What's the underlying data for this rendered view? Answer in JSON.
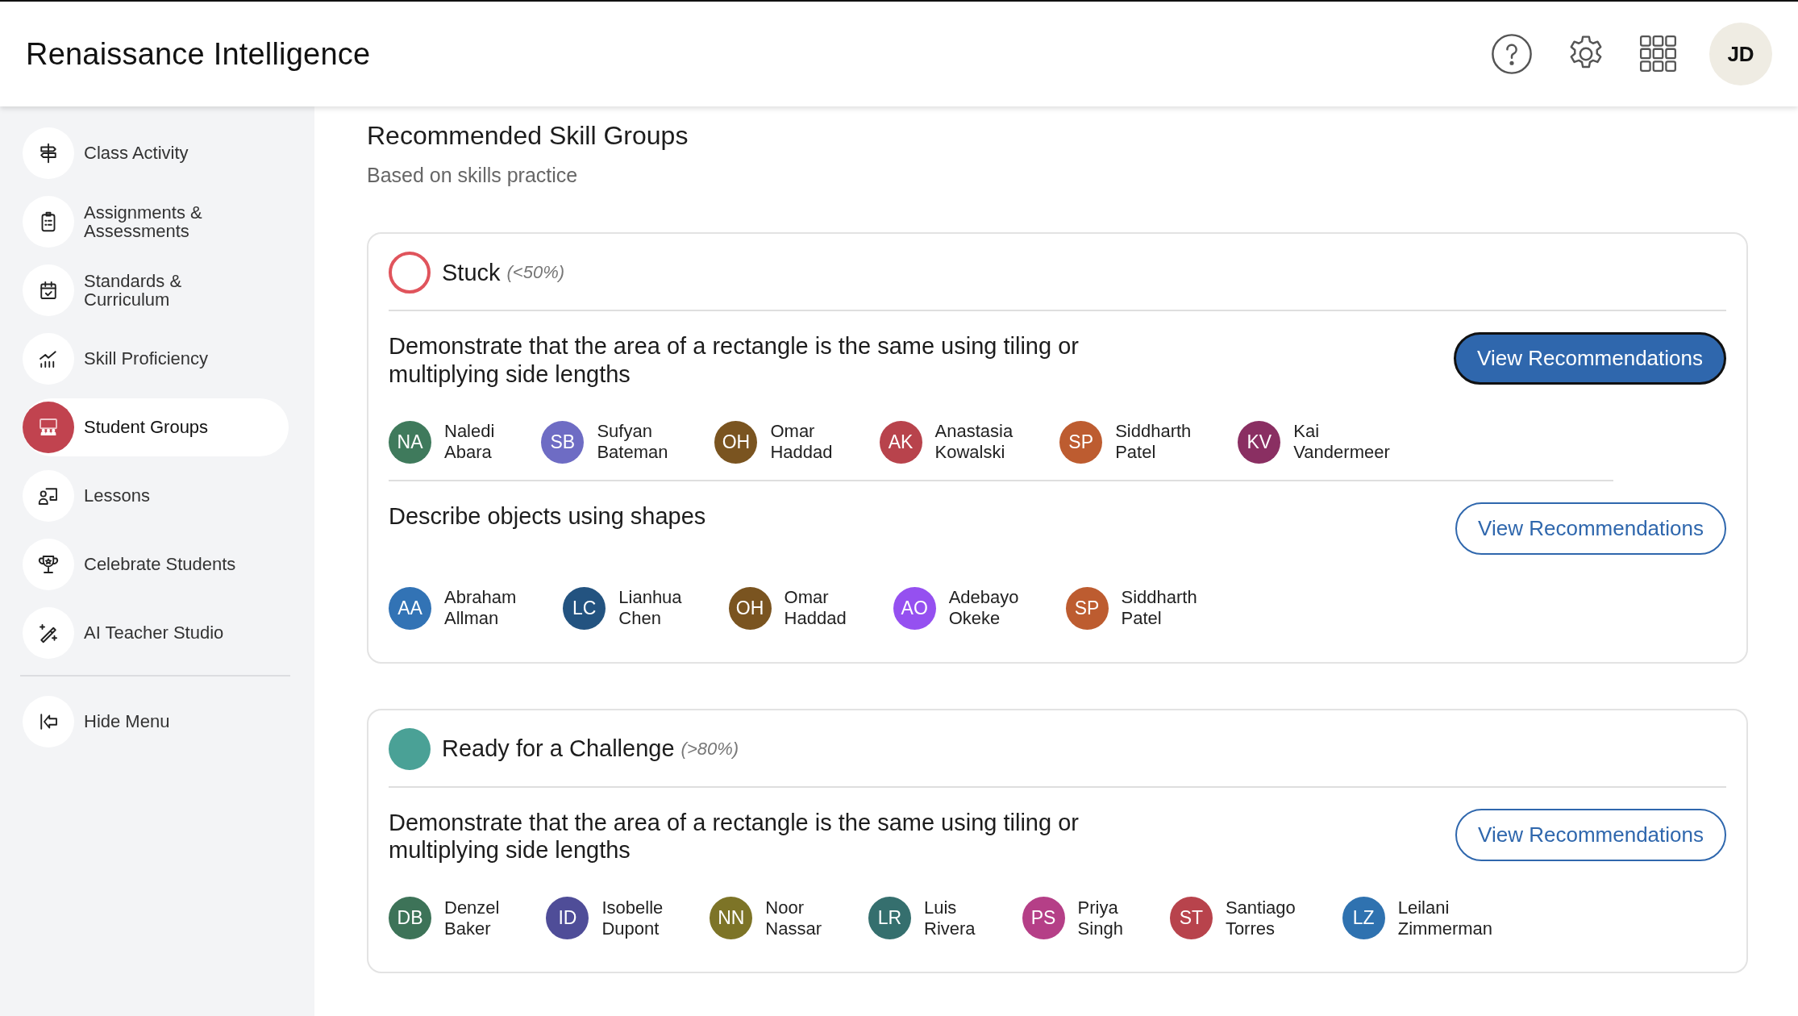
{
  "header": {
    "logo": "Renaissance Intelligence",
    "user_initials": "JD"
  },
  "sidebar": {
    "items": [
      {
        "label": "Class Activity",
        "selected": false
      },
      {
        "label": "Assignments & Assessments",
        "selected": false
      },
      {
        "label": "Standards & Curriculum",
        "selected": false
      },
      {
        "label": "Skill Proficiency",
        "selected": false
      },
      {
        "label": "Student Groups",
        "selected": true
      },
      {
        "label": "Lessons",
        "selected": false
      },
      {
        "label": "Celebrate Students",
        "selected": false
      },
      {
        "label": "AI Teacher Studio",
        "selected": false
      }
    ],
    "hide_menu": "Hide Menu"
  },
  "page": {
    "title": "Recommended Skill Groups",
    "subtitle": "Based on skills practice"
  },
  "groups": [
    {
      "name": "Stuck",
      "range": "(<50%)",
      "kind": "hollow",
      "color": "#e0545c",
      "skills": [
        {
          "title": "Demonstrate that the area of a rectangle is the same using tiling or multiplying side lengths",
          "button": "View Recommendations",
          "focused": true,
          "students": [
            {
              "initials": "NA",
              "first": "Naledi",
              "last": "Abara",
              "color": "#3f7a5c"
            },
            {
              "initials": "SB",
              "first": "Sufyan",
              "last": "Bateman",
              "color": "#6e6cc4"
            },
            {
              "initials": "OH",
              "first": "Omar",
              "last": "Haddad",
              "color": "#7a5420"
            },
            {
              "initials": "AK",
              "first": "Anastasia",
              "last": "Kowalski",
              "color": "#b8434c"
            },
            {
              "initials": "SP",
              "first": "Siddharth",
              "last": "Patel",
              "color": "#bd5c30"
            },
            {
              "initials": "KV",
              "first": "Kai",
              "last": "Vandermeer",
              "color": "#8a2f62"
            }
          ]
        },
        {
          "title": "Describe objects using shapes",
          "button": "View Recommendations",
          "focused": false,
          "students": [
            {
              "initials": "AA",
              "first": "Abraham",
              "last": "Allman",
              "color": "#3273b5"
            },
            {
              "initials": "LC",
              "first": "Lianhua",
              "last": "Chen",
              "color": "#235380"
            },
            {
              "initials": "OH",
              "first": "Omar",
              "last": "Haddad",
              "color": "#7a5420"
            },
            {
              "initials": "AO",
              "first": "Adebayo",
              "last": "Okeke",
              "color": "#9550f0"
            },
            {
              "initials": "SP",
              "first": "Siddharth",
              "last": "Patel",
              "color": "#bd5c30"
            }
          ]
        }
      ]
    },
    {
      "name": "Ready for a Challenge",
      "range": "(>80%)",
      "kind": "filled",
      "color": "#4aa196",
      "skills": [
        {
          "title": "Demonstrate that the area of a rectangle is the same using tiling or multiplying side lengths",
          "button": "View Recommendations",
          "focused": false,
          "students": [
            {
              "initials": "DB",
              "first": "Denzel",
              "last": "Baker",
              "color": "#3d7358"
            },
            {
              "initials": "ID",
              "first": "Isobelle",
              "last": "Dupont",
              "color": "#4f4d98"
            },
            {
              "initials": "NN",
              "first": "Noor",
              "last": "Nassar",
              "color": "#7d7427"
            },
            {
              "initials": "LR",
              "first": "Luis",
              "last": "Rivera",
              "color": "#356f6e"
            },
            {
              "initials": "PS",
              "first": "Priya",
              "last": "Singh",
              "color": "#b53f87"
            },
            {
              "initials": "ST",
              "first": "Santiago",
              "last": "Torres",
              "color": "#b8434c"
            },
            {
              "initials": "LZ",
              "first": "Leilani",
              "last": "Zimmerman",
              "color": "#2f72b0"
            }
          ]
        }
      ]
    }
  ]
}
